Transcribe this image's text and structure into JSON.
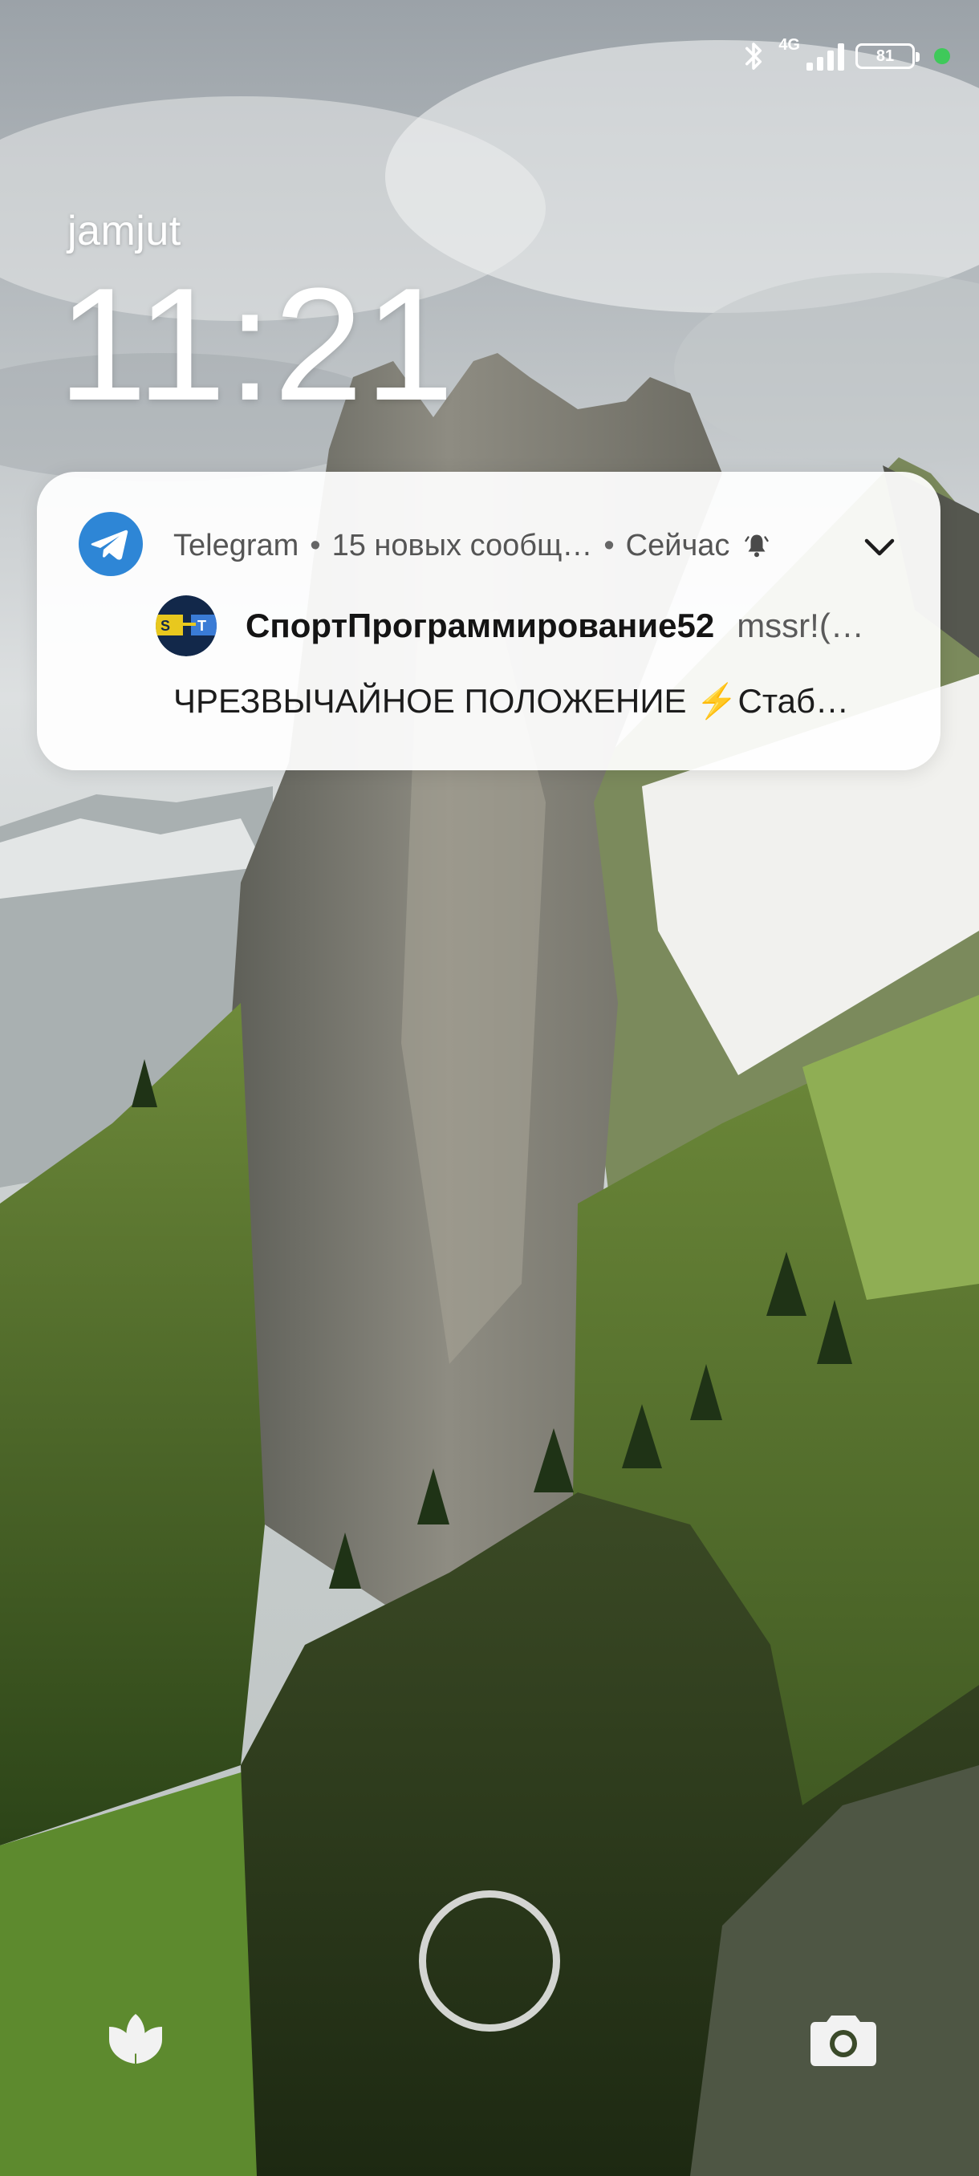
{
  "status_bar": {
    "bluetooth_icon": "bluetooth-icon",
    "network_type": "4G",
    "signal_icon": "signal-bars-icon",
    "battery_level": "81",
    "indicator_color": "#3fc95a"
  },
  "lockscreen": {
    "owner": "jamjut",
    "time": "11:21"
  },
  "notification": {
    "app_name": "Telegram",
    "summary": "15 новых сообщ…",
    "timestamp": "Сейчас",
    "app_icon": "telegram-icon",
    "bell_icon": "bell-icon",
    "expand_icon": "chevron-down-icon",
    "sender": "СпортПрограммирование52",
    "preview": "mssr!(…",
    "body": "ЧРЕЗВЫЧАЙНОЕ ПОЛОЖЕНИЕ ⚡Стаб…",
    "accent_color": "#2e86d6"
  },
  "bottom": {
    "left_shortcut_icon": "leaf-icon",
    "camera_icon": "camera-icon",
    "unlock_icon": "fingerprint-ring-icon"
  }
}
